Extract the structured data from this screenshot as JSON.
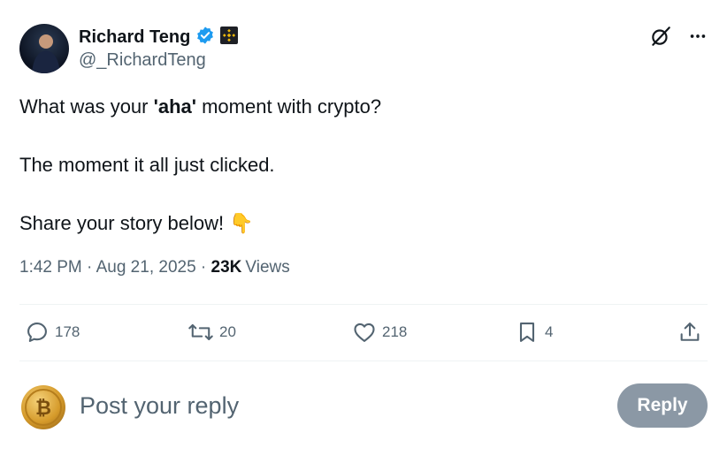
{
  "author": {
    "name": "Richard Teng",
    "handle": "@_RichardTeng"
  },
  "tweet": {
    "line1_pre": "What was your ",
    "line1_bold": "'aha'",
    "line1_post": " moment with crypto?",
    "line2": "The moment it all just clicked.",
    "line3": "Share your story below!",
    "line3_emoji": "👇"
  },
  "meta": {
    "timestamp": "1:42 PM · Aug 21, 2025",
    "separator": "·",
    "views_count": "23K",
    "views_label": "Views"
  },
  "stats": {
    "replies": "178",
    "reposts": "20",
    "likes": "218",
    "bookmarks": "4"
  },
  "reply_box": {
    "placeholder": "Post your reply",
    "button_label": "Reply"
  },
  "colors": {
    "verified": "#1d9bf0",
    "text": "#0f1419",
    "muted": "#536471",
    "reply_button": "#8b98a5",
    "affiliate": "#f0b90b"
  }
}
